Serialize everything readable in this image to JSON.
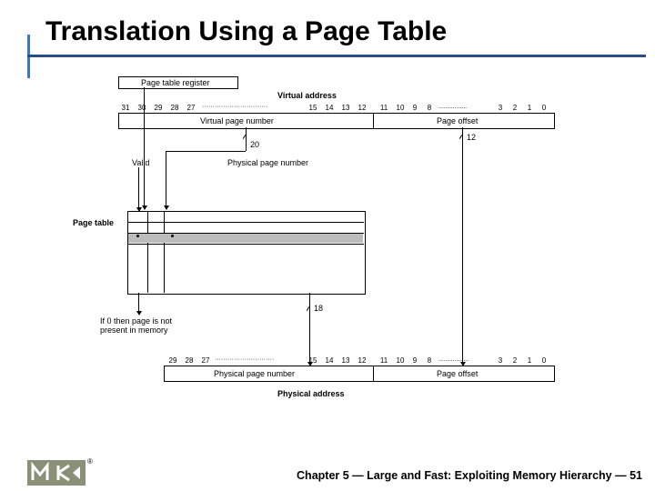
{
  "title": "Translation Using a Page Table",
  "page_table_register": "Page table register",
  "virtual_address": "Virtual address",
  "virtual_page_number": "Virtual page number",
  "page_offset": "Page offset",
  "valid": "Valid",
  "physical_page_number": "Physical page number",
  "page_table": "Page table",
  "not_present": "If 0 then page is not\npresent in memory",
  "physical_address": "Physical address",
  "width20": "20",
  "width12": "12",
  "width18": "18",
  "bits_virtual": [
    "31",
    "30",
    "29",
    "28",
    "27",
    "15",
    "14",
    "13",
    "12",
    "11",
    "10",
    "9",
    "8",
    "3",
    "2",
    "1",
    "0"
  ],
  "bits_physical": [
    "29",
    "28",
    "27",
    "15",
    "14",
    "13",
    "12",
    "11",
    "10",
    "9",
    "8",
    "3",
    "2",
    "1",
    "0"
  ],
  "footer": "Chapter 5 — Large and Fast: Exploiting Memory Hierarchy — 51"
}
